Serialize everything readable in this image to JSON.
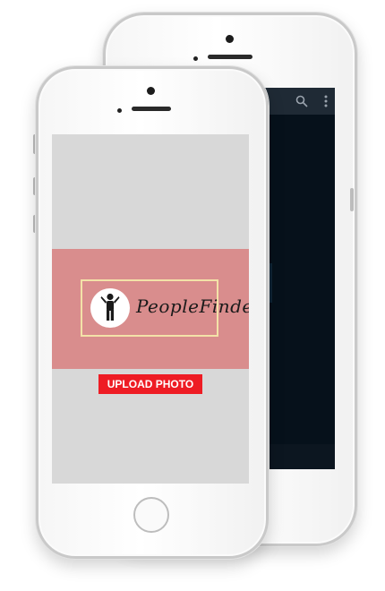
{
  "app": {
    "name": "PeopleFinder",
    "upload_label": "UPLOAD PHOTO"
  },
  "icons": {
    "back_search": "search-icon",
    "back_menu": "kebab-menu-icon",
    "logo": "person-raising-hand-icon"
  },
  "colors": {
    "banner": "#d98d8d",
    "upload_button": "#ee1c24",
    "screen_background": "#d8d8d8",
    "back_screen": "#06111b",
    "logo_frame": "#f3e2a8"
  }
}
